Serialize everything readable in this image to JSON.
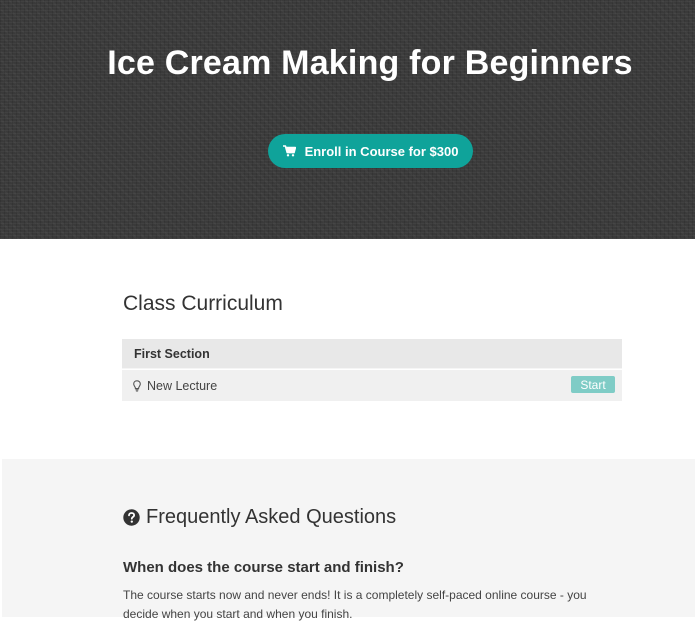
{
  "hero": {
    "title": "Ice Cream Making for Beginners",
    "enroll_label": "Enroll in Course for $300",
    "enroll_icon": "shopping-cart-icon",
    "accent_color": "#0fa39a"
  },
  "curriculum": {
    "title": "Class Curriculum",
    "sections": [
      {
        "title": "First Section",
        "lectures": [
          {
            "icon": "lightbulb-icon",
            "label": "New Lecture",
            "action_label": "Start"
          }
        ]
      }
    ]
  },
  "faq": {
    "icon": "question-circle-icon",
    "title": "Frequently Asked Questions",
    "items": [
      {
        "question": "When does the course start and finish?",
        "answer": "The course starts now and never ends! It is a completely self-paced online course - you decide when you start and when you finish."
      }
    ]
  }
}
